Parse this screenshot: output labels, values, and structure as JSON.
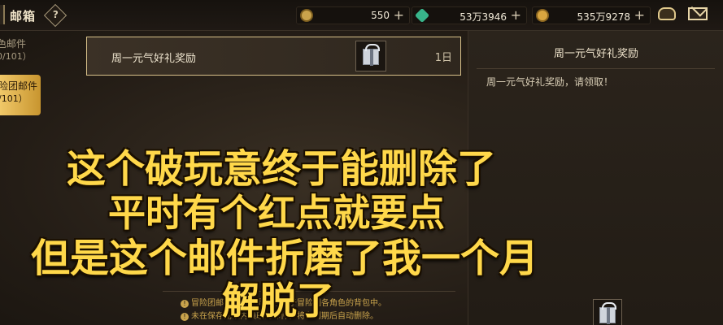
{
  "header": {
    "title": "邮箱",
    "help_symbol": "?",
    "currencies": [
      {
        "icon": "gold-coin-icon",
        "value": "550",
        "plus": "+",
        "color": "#c9a34c"
      },
      {
        "icon": "green-gem-icon",
        "value": "53万3946",
        "plus": "+",
        "color": "#38b48a"
      },
      {
        "icon": "gold-token-icon",
        "value": "535万9278",
        "plus": "+",
        "color": "#d9a640"
      }
    ],
    "icons": [
      "bag-icon",
      "mail-icon"
    ]
  },
  "sidebar": {
    "items": [
      {
        "line1": "色邮件",
        "line2": "0/101）",
        "active": false
      },
      {
        "line1": "险团邮件",
        "line2": "/101）",
        "active": true
      }
    ]
  },
  "mail_list": [
    {
      "subject": "周一元气好礼奖励",
      "days_left": "1日",
      "attachment_icon": "gift-box-icon"
    }
  ],
  "detail": {
    "title": "周一元气好礼奖励",
    "body": "周一元气好礼奖励，请领取！"
  },
  "notices": [
    "冒险团邮件中的物品将存放于冒险团各角色的背包中。",
    "未在保存期限内领取的邮件，将在到期后自动删除。"
  ],
  "caption": {
    "lines": [
      "这个破玩意终于能删除了",
      "平时有个红点就要点",
      "但是这个邮件折磨了我一个月",
      "解脱了"
    ]
  },
  "colors": {
    "accent_gold": "#d8c18a",
    "caption_yellow": "#ffd84a",
    "active_tab": "#e9bd5a"
  }
}
